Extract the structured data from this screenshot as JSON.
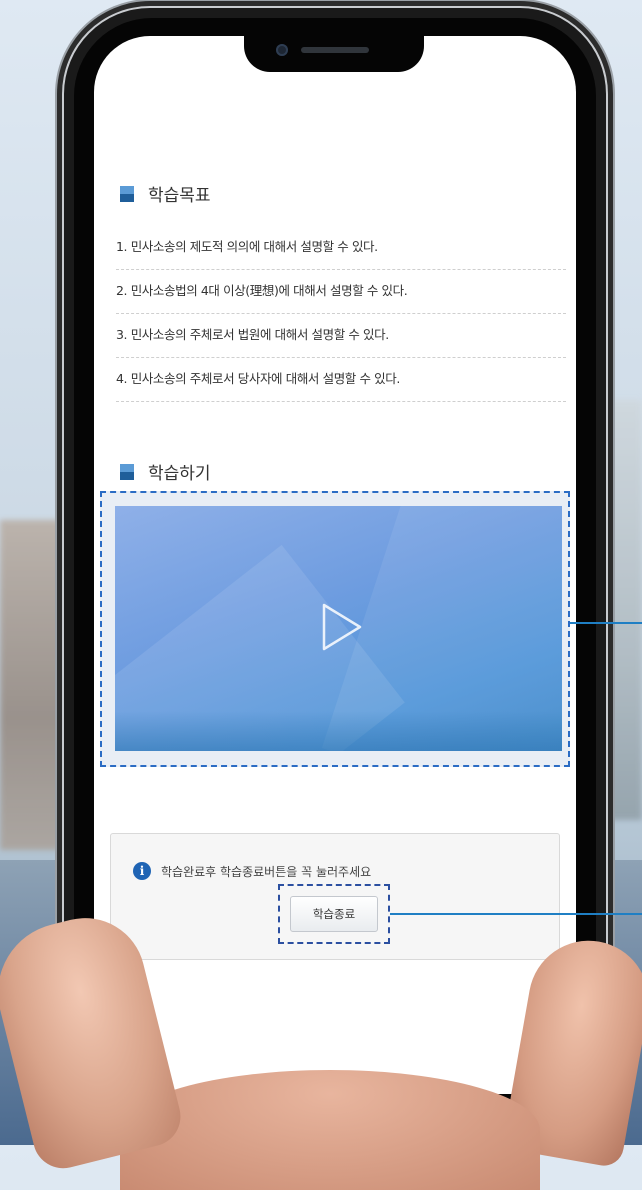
{
  "goals": {
    "title": "학습목표",
    "items": [
      "1. 민사소송의 제도적 의의에 대해서 설명할 수 있다.",
      "2. 민사소송법의 4대 이상(理想)에 대해서 설명할 수 있다.",
      "3. 민사소송의 주체로서 법원에 대해서 설명할 수 있다.",
      "4. 민사소송의 주체로서 당사자에 대해서 설명할 수 있다."
    ]
  },
  "study": {
    "title": "학습하기"
  },
  "video": {
    "play_icon": "play-icon"
  },
  "notice": {
    "icon": "info-icon",
    "icon_glyph": "i",
    "text": "학습완료후 학습종료버튼을 꼭 눌러주세요",
    "end_button_label": "학습종료"
  },
  "colors": {
    "accent": "#1f64b4",
    "highlight_border": "#2b6cc4",
    "callout": "#1f7fc4"
  }
}
